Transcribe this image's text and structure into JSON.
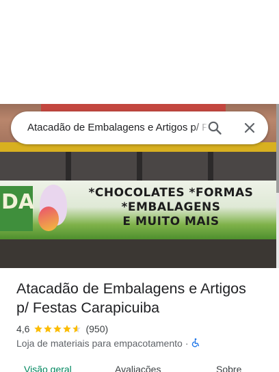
{
  "search": {
    "query": "Atacadão de Embalagens e Artigos p/ Festas Carapicuiba",
    "search_icon": "search-icon",
    "close_icon": "close-icon"
  },
  "photo": {
    "banner_lines": [
      "*CHOCOLATES *FORMAS",
      "*EMBALAGENS",
      "E MUITO MAIS"
    ],
    "logo_letters": "DA"
  },
  "place": {
    "name_line1": "Atacadão de Embalagens e Artigos",
    "name_line2": "p/ Festas Carapicuiba",
    "rating": "4,6",
    "rating_value": 4.6,
    "review_count": "(950)",
    "category": "Loja de materiais para empacotamento",
    "separator": "·",
    "accessibility_icon": "wheelchair-icon"
  },
  "tabs": [
    {
      "label": "Visão geral",
      "active": true
    },
    {
      "label": "Avaliações",
      "active": false
    },
    {
      "label": "Sobre",
      "active": false
    }
  ],
  "colors": {
    "star": "#fbbc04",
    "accent": "#0b57d0",
    "active_tab": "#01875f"
  }
}
